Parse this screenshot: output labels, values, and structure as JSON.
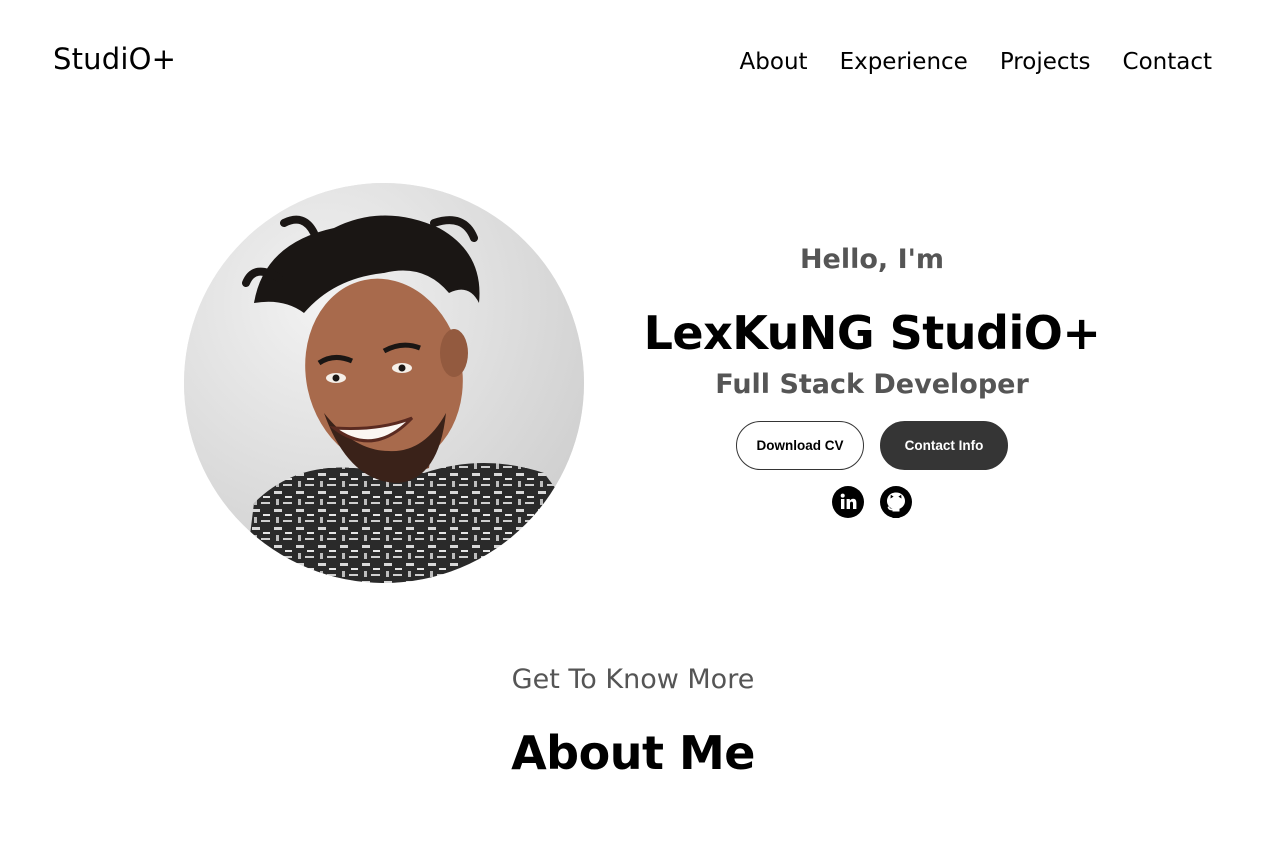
{
  "nav": {
    "logo": "StudiO+",
    "links": [
      {
        "label": "About"
      },
      {
        "label": "Experience"
      },
      {
        "label": "Projects"
      },
      {
        "label": "Contact"
      }
    ]
  },
  "hero": {
    "greeting": "Hello, I'm",
    "name": "LexKuNG StudiO+",
    "role": "Full Stack Developer",
    "buttons": {
      "download": "Download CV",
      "contact": "Contact Info"
    },
    "socials": [
      {
        "icon": "linkedin-icon"
      },
      {
        "icon": "github-icon"
      }
    ]
  },
  "about": {
    "subtitle": "Get To Know More",
    "title": "About Me"
  },
  "colors": {
    "text": "#000000",
    "muted": "#555555",
    "button_dark": "#353535",
    "background": "#ffffff"
  }
}
